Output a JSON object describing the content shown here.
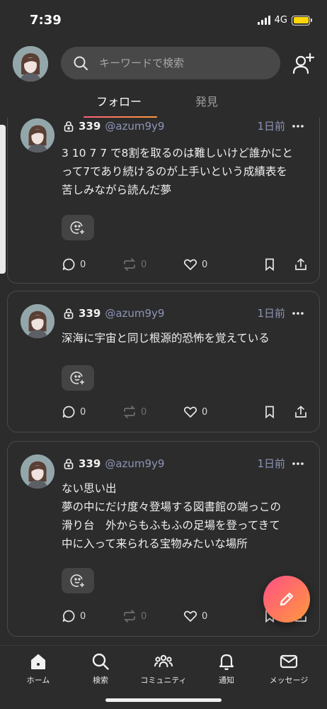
{
  "status": {
    "time": "7:39",
    "network": "4G"
  },
  "header": {
    "search_placeholder": "キーワードで検索"
  },
  "tabs": [
    {
      "label": "フォロー",
      "active": true
    },
    {
      "label": "発見",
      "active": false
    }
  ],
  "posts": [
    {
      "username": "339",
      "handle": "@azum9y9",
      "time": "1日前",
      "text": "3 10 7 7 で8割を取るのは難しいけど誰かにと\nって7であり続けるのが上手いという成績表を\n苦しみながら読んだ夢",
      "replies": "0",
      "reposts": "0",
      "likes": "0"
    },
    {
      "username": "339",
      "handle": "@azum9y9",
      "time": "1日前",
      "text": "深海に宇宙と同じ根源的恐怖を覚えている",
      "replies": "0",
      "reposts": "0",
      "likes": "0"
    },
    {
      "username": "339",
      "handle": "@azum9y9",
      "time": "1日前",
      "text": "ない思い出\n夢の中にだけ度々登場する図書館の端っこの\n滑り台　外からもふもふの足場を登ってきて\n中に入って来られる宝物みたいな場所",
      "replies": "0",
      "reposts": "0",
      "likes": "0"
    }
  ],
  "nav": [
    {
      "label": "ホーム",
      "icon": "home-icon"
    },
    {
      "label": "検索",
      "icon": "search-icon"
    },
    {
      "label": "コミュニティ",
      "icon": "community-icon"
    },
    {
      "label": "通知",
      "icon": "bell-icon"
    },
    {
      "label": "メッセージ",
      "icon": "mail-icon"
    }
  ],
  "colors": {
    "accent_start": "#ff4f86",
    "accent_end": "#ff9a3c",
    "handle": "#8e95b8",
    "battery": "#ffd60a"
  }
}
